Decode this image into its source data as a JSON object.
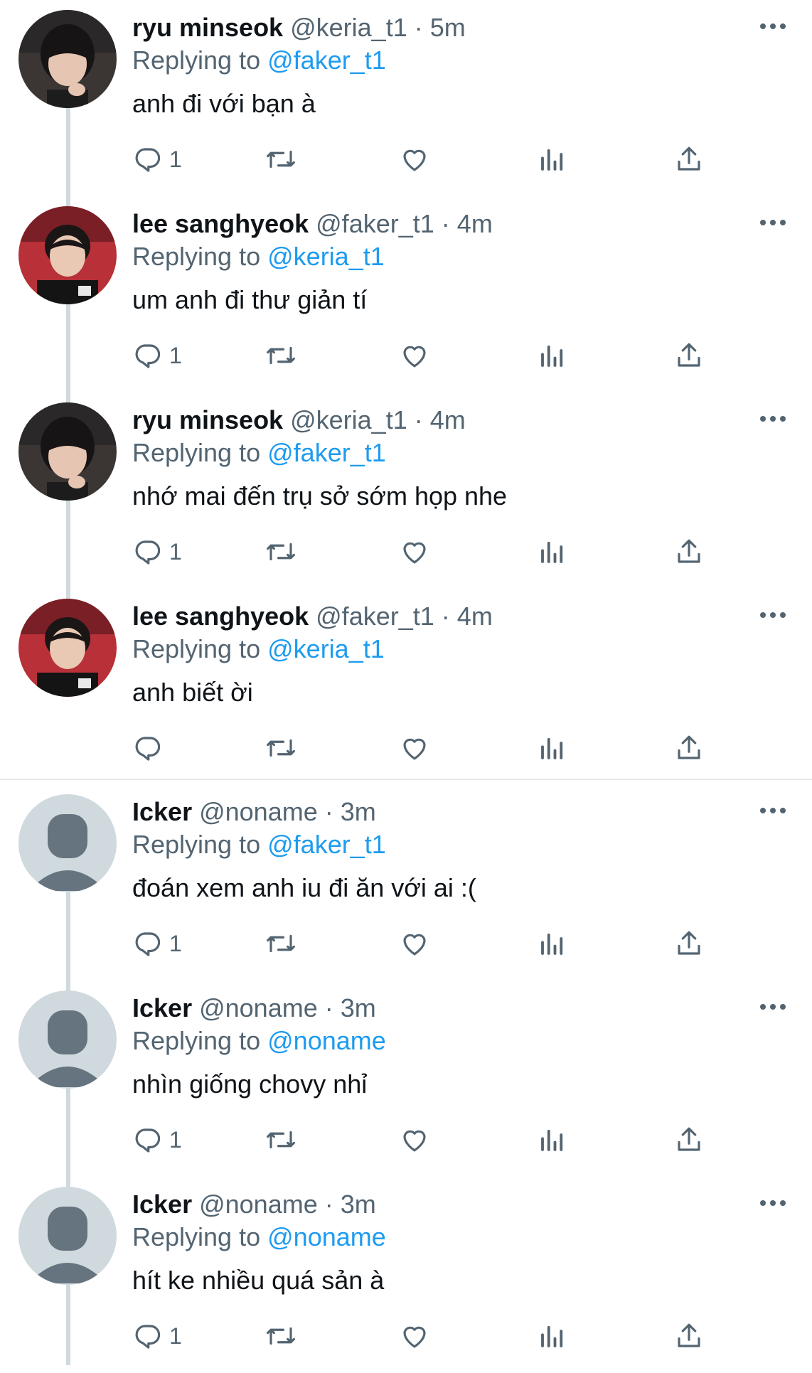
{
  "tweets": [
    {
      "display_name": "ryu minseok",
      "handle": "@keria_t1",
      "separator": "·",
      "time": "5m",
      "reply_prefix": "Replying to",
      "reply_target": "@faker_t1",
      "text": "anh đi với bạn à",
      "reply_count": "1",
      "avatar": "photo-keria"
    },
    {
      "display_name": "lee sanghyeok",
      "handle": "@faker_t1",
      "separator": "·",
      "time": "4m",
      "reply_prefix": "Replying to",
      "reply_target": "@keria_t1",
      "text": "um anh đi thư giản tí",
      "reply_count": "1",
      "avatar": "photo-faker"
    },
    {
      "display_name": "ryu minseok",
      "handle": "@keria_t1",
      "separator": "·",
      "time": "4m",
      "reply_prefix": "Replying to",
      "reply_target": "@faker_t1",
      "text": "nhớ mai đến trụ sở sớm họp nhe",
      "reply_count": "1",
      "avatar": "photo-keria"
    },
    {
      "display_name": "lee sanghyeok",
      "handle": "@faker_t1",
      "separator": "·",
      "time": "4m",
      "reply_prefix": "Replying to",
      "reply_target": "@keria_t1",
      "text": "anh biết ời",
      "reply_count": "",
      "avatar": "photo-faker"
    },
    {
      "display_name": "Icker",
      "handle": "@noname",
      "separator": "·",
      "time": "3m",
      "reply_prefix": "Replying to",
      "reply_target": "@faker_t1",
      "text": "đoán xem anh iu đi ăn với ai :(",
      "reply_count": "1",
      "avatar": "default-avatar"
    },
    {
      "display_name": "Icker",
      "handle": "@noname",
      "separator": "·",
      "time": "3m",
      "reply_prefix": "Replying to",
      "reply_target": "@noname",
      "text": "nhìn giống chovy nhỉ",
      "reply_count": "1",
      "avatar": "default-avatar"
    },
    {
      "display_name": "Icker",
      "handle": "@noname",
      "separator": "·",
      "time": "3m",
      "reply_prefix": "Replying to",
      "reply_target": "@noname",
      "text": "hít ke nhiều quá sản à",
      "reply_count": "1",
      "avatar": "default-avatar"
    }
  ],
  "icons": {
    "more": "more-icon",
    "reply": "reply-icon",
    "retweet": "retweet-icon",
    "like": "like-icon",
    "views": "views-icon",
    "share": "share-icon"
  },
  "colors": {
    "text_primary": "#0f1419",
    "text_secondary": "#536471",
    "accent_link": "#1d9bf0",
    "thread_line": "#cfd9de",
    "divider": "#e6e9eb",
    "default_avatar_bg": "#cfd9de",
    "default_avatar_fg": "#66747f"
  }
}
